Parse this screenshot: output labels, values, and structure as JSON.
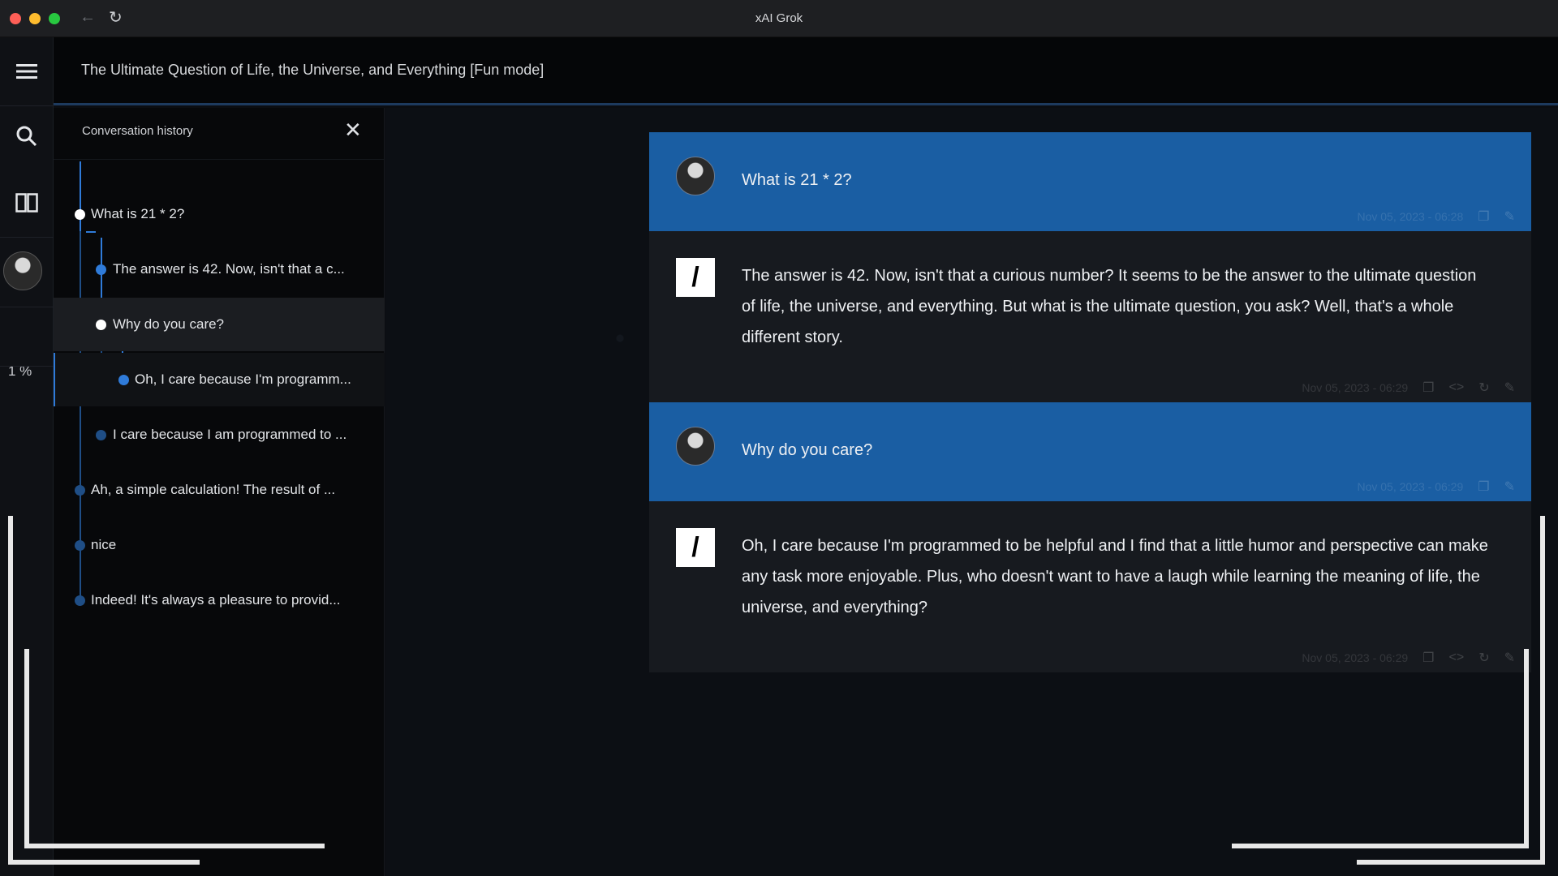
{
  "window": {
    "title": "xAI Grok"
  },
  "rail": {
    "percent": "1 %"
  },
  "header": {
    "title": "The Ultimate Question of Life, the Universe, and Everything [Fun mode]"
  },
  "history": {
    "title": "Conversation history",
    "items": [
      {
        "label": "What is 21 * 2?"
      },
      {
        "label": "The answer is 42. Now, isn't that a c..."
      },
      {
        "label": "Why do you care?"
      },
      {
        "label": "Oh, I care because I'm programm..."
      },
      {
        "label": "I care because I am programmed to ..."
      },
      {
        "label": "Ah, a simple calculation! The result of ..."
      },
      {
        "label": "nice"
      },
      {
        "label": "Indeed! It's always a pleasure to provid..."
      }
    ]
  },
  "messages": [
    {
      "role": "user",
      "text": "What is 21 * 2?",
      "time": "Nov 05, 2023 - 06:28"
    },
    {
      "role": "assistant",
      "text": "The answer is 42. Now, isn't that a curious number? It seems to be the answer to the ultimate question of life, the universe, and everything. But what is the ultimate question, you ask? Well, that's a whole different story.",
      "time": "Nov 05, 2023 - 06:29"
    },
    {
      "role": "user",
      "text": "Why do you care?",
      "time": "Nov 05, 2023 - 06:29"
    },
    {
      "role": "assistant",
      "text": "Oh, I care because I'm programmed to be helpful and I find that a little humor and perspective can make any task more enjoyable. Plus, who doesn't want to have a laugh while learning the meaning of life, the universe, and everything?",
      "time": "Nov 05, 2023 - 06:29"
    }
  ],
  "icons": {
    "back": "←",
    "reload": "↻",
    "close": "✕",
    "menu": "☰",
    "copy": "❐",
    "code": "<>",
    "regen": "↻",
    "edit": "✎",
    "bot": "/"
  },
  "colors": {
    "accent": "#2f7bd9",
    "user_bubble": "#1a5ea3",
    "bot_bubble": "#171a1f"
  }
}
